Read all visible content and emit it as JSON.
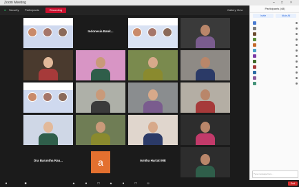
{
  "window": {
    "title": "Zoom Meeting"
  },
  "topbar": {
    "security_label": "Security",
    "participants_label": "Participants",
    "recording_label": "Recording",
    "view_label": "Gallery View"
  },
  "tiles": [
    {
      "name": "",
      "kind": "banner",
      "bg": "#cfd9ef"
    },
    {
      "name": "",
      "kind": "text",
      "text": "Indonesia Bank...",
      "bg": "#1b1b1b"
    },
    {
      "name": "",
      "kind": "banner",
      "bg": "#d9e2f3"
    },
    {
      "name": "",
      "kind": "person",
      "bg": "#3a3a3a"
    },
    {
      "name": "",
      "kind": "person",
      "bg": "#4a3a2e"
    },
    {
      "name": "",
      "kind": "person",
      "bg": "#d895c5"
    },
    {
      "name": "",
      "kind": "person",
      "bg": "#7a8a4e"
    },
    {
      "name": "",
      "kind": "person",
      "bg": "#8e8a85"
    },
    {
      "name": "",
      "kind": "banner",
      "bg": "#cfd9ef"
    },
    {
      "name": "",
      "kind": "person",
      "bg": "#aeb0a8"
    },
    {
      "name": "",
      "kind": "person",
      "bg": "#8a8d8f"
    },
    {
      "name": "",
      "kind": "person",
      "bg": "#b4aea4"
    },
    {
      "name": "",
      "kind": "person",
      "bg": "#cfd7e6"
    },
    {
      "name": "",
      "kind": "person",
      "bg": "#6f7d55"
    },
    {
      "name": "",
      "kind": "person",
      "bg": "#e0d6cd"
    },
    {
      "name": "",
      "kind": "person",
      "bg": "#2d2d2d"
    },
    {
      "name": "",
      "kind": "text",
      "text": "Dra Baruntha Rau...",
      "bg": "#1b1b1b"
    },
    {
      "name": "",
      "kind": "avatar",
      "text": "a",
      "bg": "#1b1b1b"
    },
    {
      "name": "",
      "kind": "text",
      "text": "Ismiha Hartati ME",
      "bg": "#1b1b1b"
    },
    {
      "name": "",
      "kind": "person",
      "bg": "#2d2d2d"
    }
  ],
  "toolbar": {
    "end_label": "End"
  },
  "panel": {
    "title": "Participants (48)",
    "invite_label": "Invite",
    "mute_all_label": "Mute All",
    "participants": [
      {
        "name": "",
        "color": "#4a7bd1"
      },
      {
        "name": "",
        "color": "#7b7b7b"
      },
      {
        "name": "",
        "color": "#6b4a2e"
      },
      {
        "name": "",
        "color": "#5a8d3a"
      },
      {
        "name": "",
        "color": "#c46a2c"
      },
      {
        "name": "",
        "color": "#4aa1c7"
      },
      {
        "name": "",
        "color": "#7b3aa5"
      },
      {
        "name": "",
        "color": "#3f6b2a"
      },
      {
        "name": "",
        "color": "#a53a3a"
      },
      {
        "name": "",
        "color": "#2c6da5"
      },
      {
        "name": "",
        "color": "#8a5a9b"
      },
      {
        "name": "",
        "color": "#45937a"
      }
    ],
    "chat_messages": [
      "",
      "",
      "",
      "",
      "",
      "",
      "",
      "",
      "",
      "",
      "",
      "",
      ""
    ],
    "chat_placeholder": "Type message here..."
  }
}
